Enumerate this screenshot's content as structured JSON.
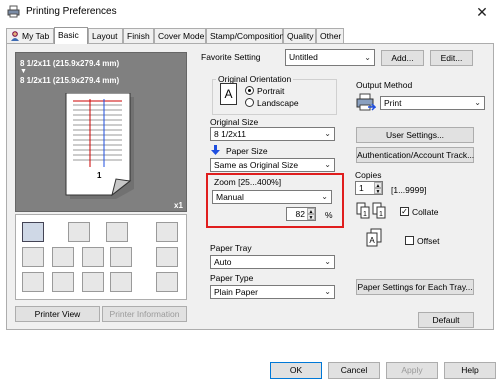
{
  "window": {
    "title": "Printing Preferences",
    "close_glyph": "✕"
  },
  "tabs": [
    "My Tab",
    "Basic",
    "Layout",
    "Finish",
    "Cover Mode",
    "Stamp/Composition",
    "Quality",
    "Other"
  ],
  "preview": {
    "line1": "8 1/2x11 (215.9x279.4 mm)",
    "arrow": "▼",
    "line2": "8 1/2x11 (215.9x279.4 mm)",
    "copies_badge": "x1",
    "page_number": "1"
  },
  "left_buttons": {
    "printer_view": "Printer View",
    "printer_information": "Printer Information"
  },
  "favorite": {
    "label": "Favorite Setting",
    "value": "Untitled",
    "add": "Add...",
    "edit": "Edit..."
  },
  "orientation": {
    "group_label": "Original Orientation",
    "portrait": "Portrait",
    "landscape": "Landscape",
    "selected": "Portrait"
  },
  "original_size": {
    "label": "Original Size",
    "value": "8 1/2x11"
  },
  "paper_size": {
    "label": "Paper Size",
    "value": "Same as Original Size"
  },
  "zoom": {
    "label": "Zoom [25...400%]",
    "mode": "Manual",
    "value": "82",
    "unit": "%"
  },
  "paper_tray": {
    "label": "Paper Tray",
    "value": "Auto"
  },
  "paper_type": {
    "label": "Paper Type",
    "value": "Plain Paper"
  },
  "output": {
    "label": "Output Method",
    "value": "Print",
    "user_settings": "User Settings...",
    "auth": "Authentication/Account Track..."
  },
  "copies": {
    "label": "Copies",
    "value": "1",
    "range": "[1...9999]",
    "collate": "Collate",
    "collate_checked": true,
    "offset": "Offset",
    "offset_checked": false
  },
  "paper_settings_button": "Paper Settings for Each Tray...",
  "default_button": "Default",
  "footer": {
    "ok": "OK",
    "cancel": "Cancel",
    "apply": "Apply",
    "help": "Help"
  },
  "colors": {
    "highlight_red": "#e01e1e",
    "accent_blue": "#0078d7",
    "arrow_blue": "#1f4fe0"
  }
}
